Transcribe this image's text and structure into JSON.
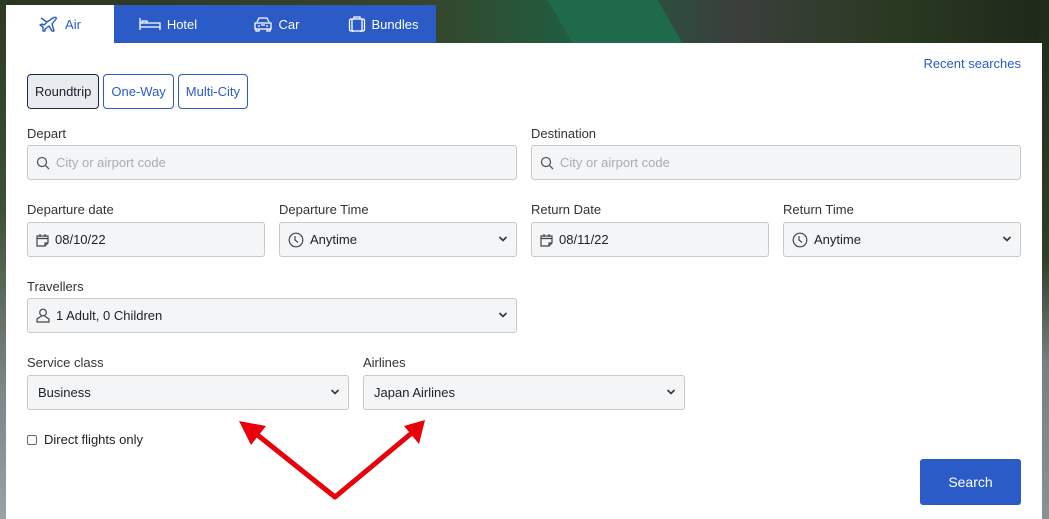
{
  "tabs": [
    {
      "label": "Air",
      "icon": "airplane-icon",
      "active": true
    },
    {
      "label": "Hotel",
      "icon": "bed-icon",
      "active": false
    },
    {
      "label": "Car",
      "icon": "car-icon",
      "active": false
    },
    {
      "label": "Bundles",
      "icon": "suitcase-icon",
      "active": false
    }
  ],
  "recent_searches": "Recent searches",
  "trip_types": [
    {
      "label": "Roundtrip",
      "active": true
    },
    {
      "label": "One-Way",
      "active": false
    },
    {
      "label": "Multi-City",
      "active": false
    }
  ],
  "form": {
    "depart": {
      "label": "Depart",
      "placeholder": "City or airport code",
      "value": ""
    },
    "destination": {
      "label": "Destination",
      "placeholder": "City or airport code",
      "value": ""
    },
    "departure_date": {
      "label": "Departure date",
      "value": "08/10/22"
    },
    "departure_time": {
      "label": "Departure Time",
      "value": "Anytime"
    },
    "return_date": {
      "label": "Return Date",
      "value": "08/11/22"
    },
    "return_time": {
      "label": "Return Time",
      "value": "Anytime"
    },
    "travellers": {
      "label": "Travellers",
      "value": "1 Adult, 0 Children"
    },
    "service_class": {
      "label": "Service class",
      "value": "Business"
    },
    "airlines": {
      "label": "Airlines",
      "value": "Japan Airlines"
    },
    "direct_flights": {
      "label": "Direct flights only",
      "checked": false
    }
  },
  "search_button": "Search",
  "colors": {
    "accent": "#2a5bc6",
    "field_bg": "#f4f5f7",
    "annotation_arrow": "#e8000b"
  }
}
